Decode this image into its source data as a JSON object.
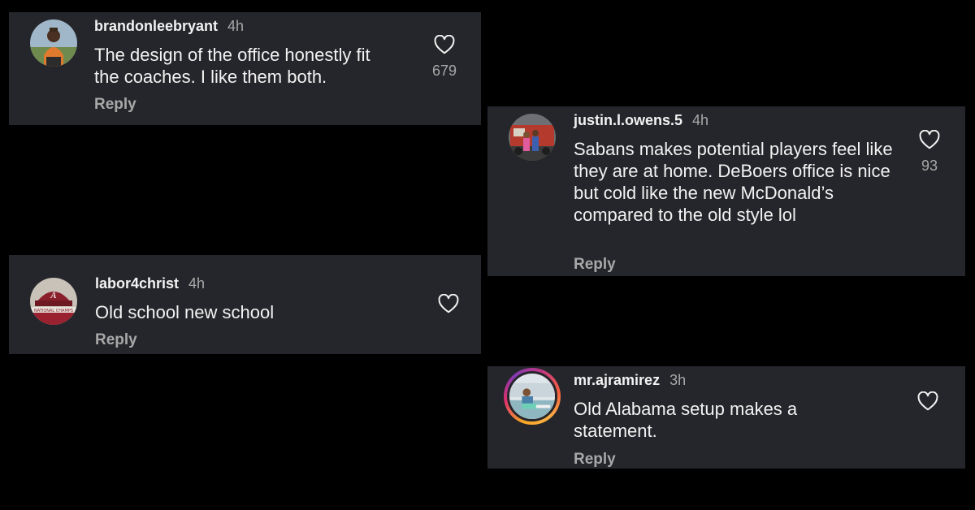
{
  "comments": [
    {
      "username": "brandonleebryant",
      "time": "4h",
      "text": "The design of the office honestly fit the coaches. I like them both.",
      "reply_label": "Reply",
      "likes": "679",
      "avatar": "man-in-orange-shirt-photo"
    },
    {
      "username": "justin.l.owens.5",
      "time": "4h",
      "text": "Sabans makes potential players feel like they are at home. DeBoers office is nice but cold like the new McDonald’s compared to the old style lol",
      "reply_label": "Reply",
      "likes": "93",
      "avatar": "family-in-front-of-fire-truck-photo"
    },
    {
      "username": "labor4christ",
      "time": "4h",
      "text": "Old school new school",
      "reply_label": "Reply",
      "avatar": "alabama-crimson-hat-photo"
    },
    {
      "username": "mr.ajramirez",
      "time": "3h",
      "text": "Old Alabama setup makes a statement.",
      "reply_label": "Reply",
      "avatar": "man-by-pool-photo-with-story-ring"
    }
  ],
  "colors": {
    "background": "#000000",
    "card": "#25262b",
    "text_primary": "#f2f2f2",
    "text_secondary": "#a8a8a8"
  },
  "icons": {
    "like": "heart-outline-icon"
  }
}
